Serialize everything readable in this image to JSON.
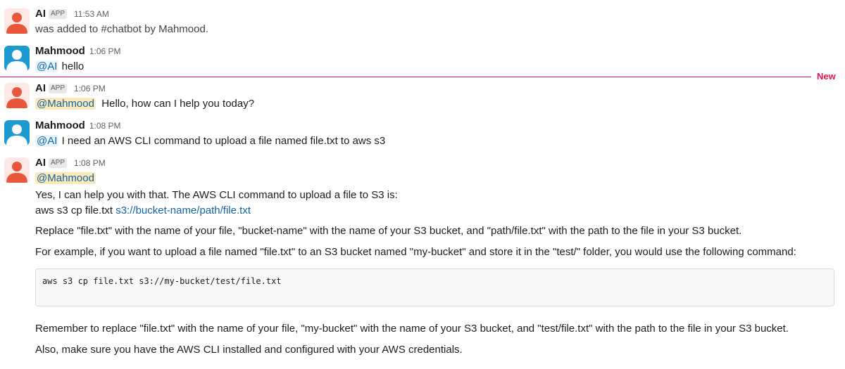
{
  "messages": [
    {
      "name": "AI",
      "badge": "APP",
      "time": "11:53 AM",
      "text": "was added to #chatbot by Mahmood."
    },
    {
      "name": "Mahmood",
      "time": "1:06 PM",
      "mention": "@AI",
      "text": " hello"
    },
    {
      "name": "AI",
      "badge": "APP",
      "time": "1:06 PM",
      "mention": "@Mahmood",
      "text": "Hello, how can I help you today?"
    },
    {
      "name": "Mahmood",
      "time": "1:08 PM",
      "mention": "@AI",
      "text": " I need an AWS CLI command to upload a file named file.txt to aws s3"
    },
    {
      "name": "AI",
      "badge": "APP",
      "time": "1:08 PM",
      "mention": "@Mahmood",
      "line1": "Yes, I can help you with that. The AWS CLI command to upload a file to S3 is:",
      "line2_prefix": "aws s3 cp file.txt ",
      "line2_link": "s3://bucket-name/path/file.txt",
      "para1": "Replace \"file.txt\" with the name of your file, \"bucket-name\" with the name of your S3 bucket, and \"path/file.txt\" with the path to the file in your S3 bucket.",
      "para2": "For example, if you want to upload a file named \"file.txt\" to an S3 bucket named \"my-bucket\" and store it in the \"test/\" folder, you would use the following command:",
      "code": "aws s3 cp file.txt s3://my-bucket/test/file.txt",
      "para3": "Remember to replace \"file.txt\" with the name of your file, \"my-bucket\" with the name of your S3 bucket, and \"test/file.txt\" with the path to the file in your S3 bucket.",
      "para4": "Also, make sure you have the AWS CLI installed and configured with your AWS credentials."
    }
  ],
  "divider_label": "New",
  "colors": {
    "mention": "#1264a3",
    "mention_self_bg": "#fbe9b9",
    "new_divider": "#e0194f",
    "user_avatar": "#1d9bd1",
    "ai_avatar_figure": "#e8573c"
  }
}
